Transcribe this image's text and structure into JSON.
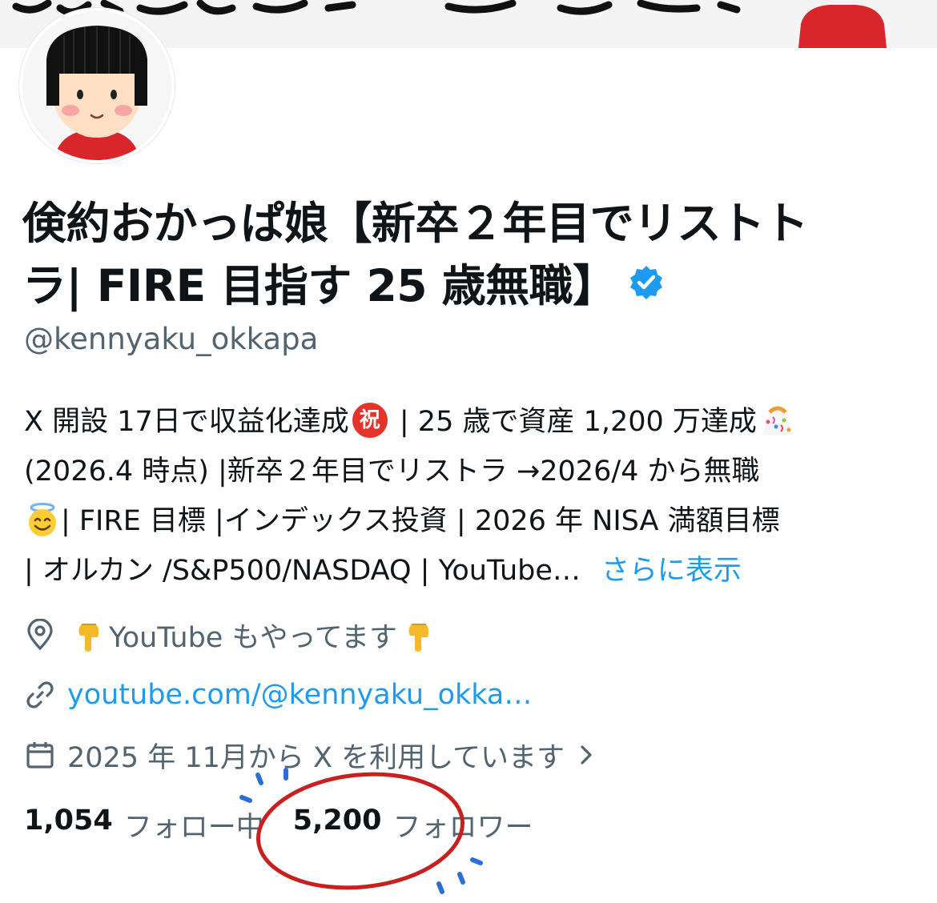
{
  "profile": {
    "display_name_line1": "倹約おかっぱ娘【新卒２年目でリストト",
    "display_name_line2": "ラ| FIRE 目指す 25 歳無職】",
    "handle": "@kennyaku_okkapa",
    "verified": true,
    "avatar_icon": "okappa-girl-avatar"
  },
  "bio": {
    "line1_a": "X 開設 17日で収益化達成",
    "line1_iwai": "祝",
    "line1_b": " | 25 歳で資産 1,200 万達成",
    "line2": "(2026.4 時点) |新卒２年目でリストラ →2026/4 から無職",
    "line3": "| FIRE 目標 |インデックス投資 | 2026 年 NISA 満額目標",
    "line4": "| オルカン /S&P500/NASDAQ | YouTube…",
    "show_more": "さらに表示"
  },
  "meta": {
    "location_text": "YouTube もやってます",
    "link_text": "youtube.com/@kennyaku_okka…",
    "joined_text": "2025 年 11月から X を利用しています"
  },
  "stats": {
    "following_count": "1,054",
    "following_label": "フォロー中",
    "followers_count": "5,200",
    "followers_label": "フォロワー"
  },
  "colors": {
    "link_blue": "#1d9bf0",
    "secondary_text": "#536471",
    "annotation_red": "#c8201f",
    "annotation_blue": "#2b6fd6"
  }
}
